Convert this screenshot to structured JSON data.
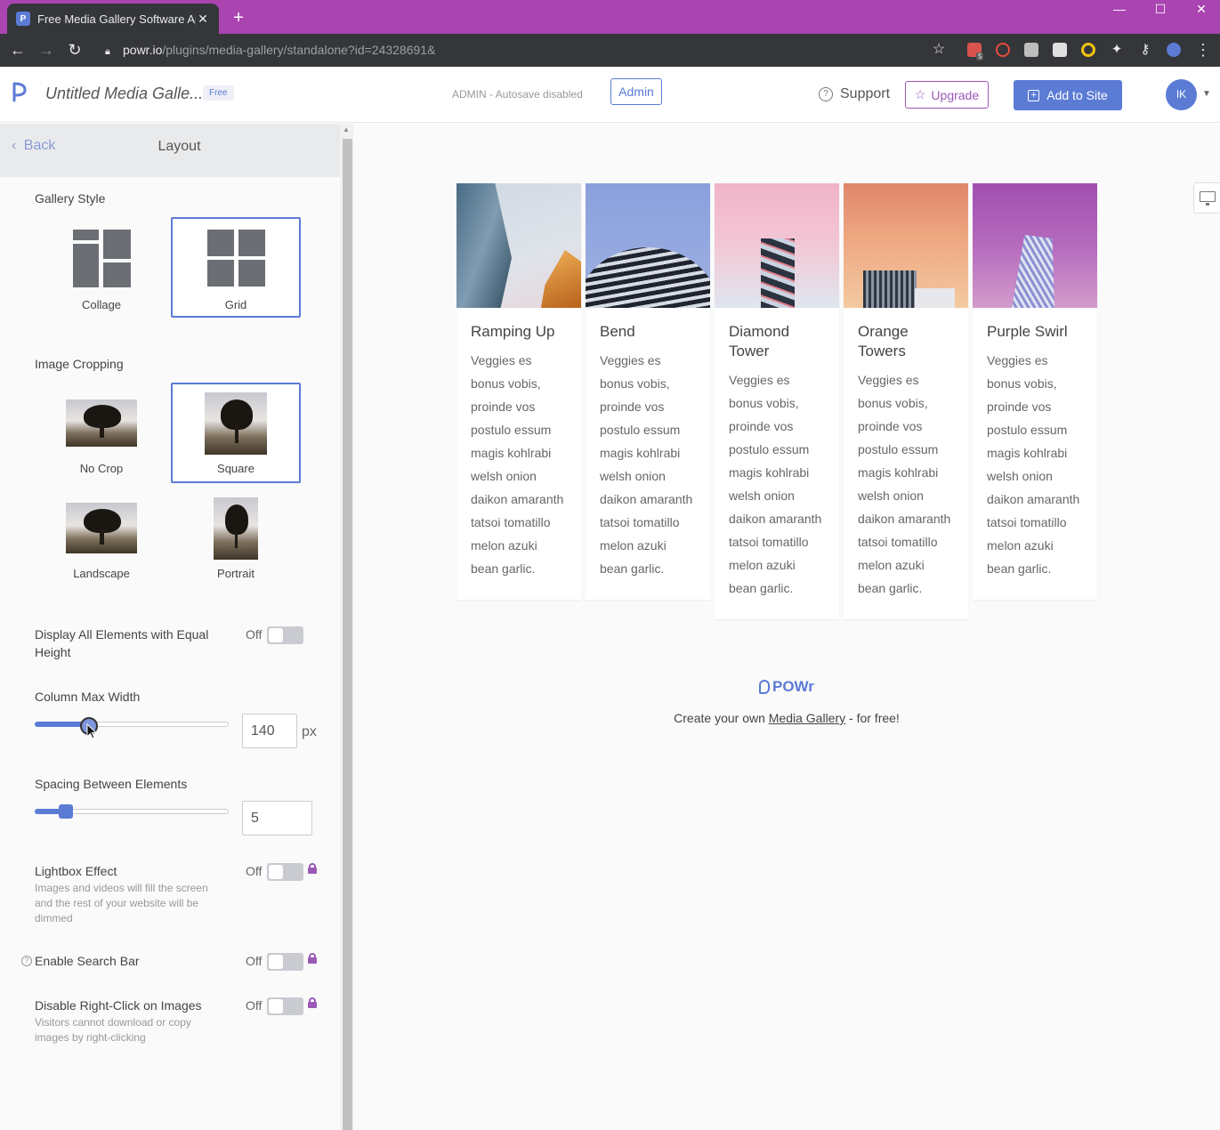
{
  "browser": {
    "tab_title": "Free Media Gallery Software Appl",
    "url_host": "powr.io",
    "url_path": "/plugins/media-gallery/standalone?id=24328691&",
    "extension_badge": "5"
  },
  "header": {
    "app_title": "Untitled Media Galle...",
    "free_badge": "Free",
    "admin_status": "ADMIN - Autosave disabled",
    "admin_button": "Admin",
    "support": "Support",
    "upgrade": "Upgrade",
    "add_to_site": "Add to Site",
    "avatar_initials": "IK"
  },
  "sidebar": {
    "back": "Back",
    "title": "Layout",
    "gallery_style": {
      "label": "Gallery Style",
      "options": [
        "Collage",
        "Grid"
      ],
      "selected": "Grid"
    },
    "image_cropping": {
      "label": "Image Cropping",
      "options": [
        "No Crop",
        "Square",
        "Landscape",
        "Portrait"
      ],
      "selected": "Square"
    },
    "equal_height": {
      "label": "Display All Elements with Equal Height",
      "state": "Off"
    },
    "column_max_width": {
      "label": "Column Max Width",
      "value": "140",
      "unit": "px",
      "slider_fraction": 0.28
    },
    "spacing": {
      "label": "Spacing Between Elements",
      "value": "5",
      "slider_fraction": 0.16
    },
    "lightbox": {
      "label": "Lightbox Effect",
      "state": "Off",
      "description": "Images and videos will fill the screen and the rest of your website will be dimmed"
    },
    "search_bar": {
      "label": "Enable Search Bar",
      "state": "Off",
      "help": "?"
    },
    "right_click": {
      "label": "Disable Right-Click on Images",
      "state": "Off",
      "description": "Visitors cannot download or copy images by right-clicking"
    }
  },
  "gallery": {
    "items": [
      {
        "title": "Ramping Up",
        "description": "Veggies es bonus vobis, proinde vos postulo essum magis kohlrabi welsh onion daikon amaranth tatsoi tomatillo melon azuki bean garlic."
      },
      {
        "title": "Bend",
        "description": "Veggies es bonus vobis, proinde vos postulo essum magis kohlrabi welsh onion daikon amaranth tatsoi tomatillo melon azuki bean garlic."
      },
      {
        "title": "Diamond Tower",
        "description": "Veggies es bonus vobis, proinde vos postulo essum magis kohlrabi welsh onion daikon amaranth tatsoi tomatillo melon azuki bean garlic."
      },
      {
        "title": "Orange Towers",
        "description": "Veggies es bonus vobis, proinde vos postulo essum magis kohlrabi welsh onion daikon amaranth tatsoi tomatillo melon azuki bean garlic."
      },
      {
        "title": "Purple Swirl",
        "description": "Veggies es bonus vobis, proinde vos postulo essum magis kohlrabi welsh onion daikon amaranth tatsoi tomatillo melon azuki bean garlic."
      }
    ]
  },
  "footer": {
    "brand": "POWr",
    "create_prefix": "Create your own ",
    "create_link": "Media Gallery",
    "create_suffix": " - for free!"
  },
  "colors": {
    "accent": "#5b7bd5",
    "upgrade": "#9b59b6",
    "titlebar": "#a944b0"
  }
}
